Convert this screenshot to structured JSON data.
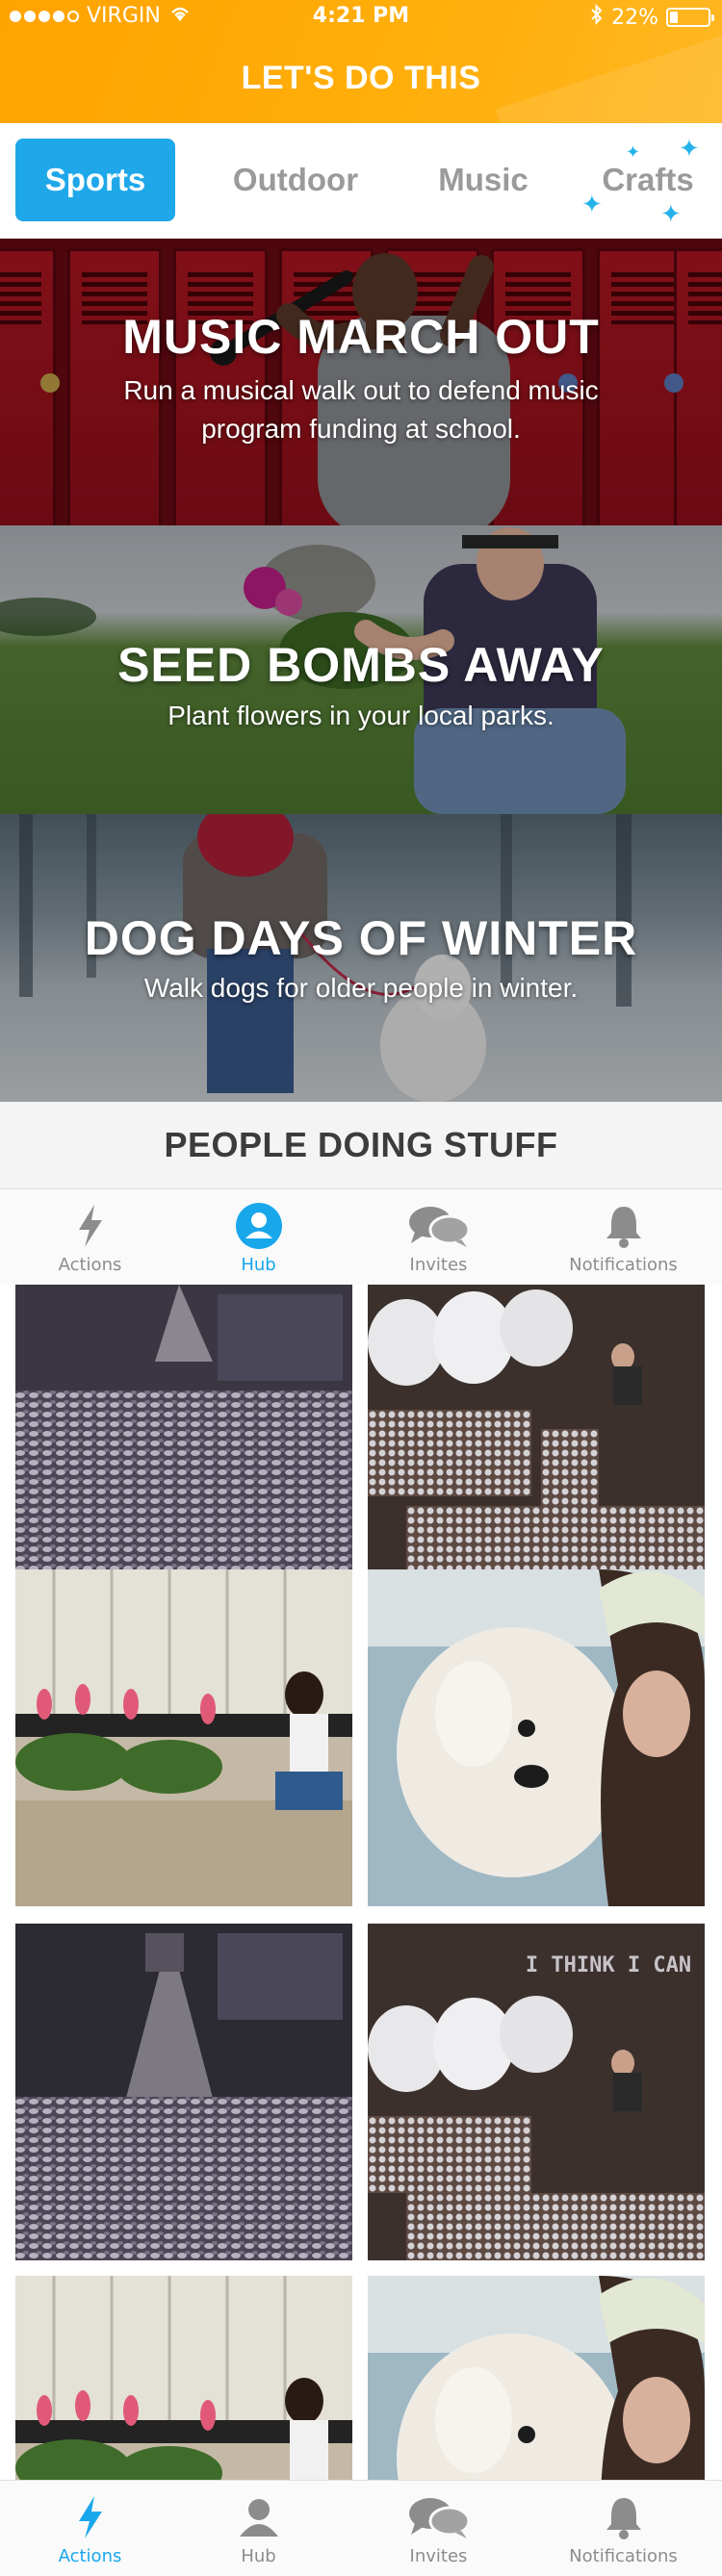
{
  "status_bar": {
    "carrier": "VIRGIN",
    "time": "4:21 PM",
    "battery_text": "22%",
    "battery_level": 0.22
  },
  "header": {
    "title": "LET'S DO THIS"
  },
  "categories": [
    {
      "label": "Sports",
      "active": true
    },
    {
      "label": "Outdoor",
      "active": false
    },
    {
      "label": "Music",
      "active": false
    },
    {
      "label": "Crafts",
      "active": false
    }
  ],
  "actions": [
    {
      "title": "MUSIC MARCH OUT",
      "description": "Run a musical walk out to defend music program funding at school."
    },
    {
      "title": "SEED BOMBS AWAY",
      "description": "Plant flowers in your local parks."
    },
    {
      "title": "DOG DAYS OF WINTER",
      "description": "Walk dogs for older people in winter."
    }
  ],
  "people_section": {
    "title": "PEOPLE DOING STUFF"
  },
  "hub_tabbar": {
    "items": [
      {
        "label": "Actions",
        "icon": "bolt-icon"
      },
      {
        "label": "Hub",
        "icon": "user-icon"
      },
      {
        "label": "Invites",
        "icon": "chat-bubbles-icon"
      },
      {
        "label": "Notifications",
        "icon": "bell-icon"
      }
    ],
    "active": "Hub"
  },
  "photos": [
    {
      "subject": "can-dress-pile"
    },
    {
      "subject": "cans-aerial-message"
    },
    {
      "subject": "girl-planting-flowers"
    },
    {
      "subject": "selfie-with-dog"
    },
    {
      "subject": "can-dress-pile"
    },
    {
      "subject": "cans-aerial-message",
      "caption": "I THINK I CAN"
    },
    {
      "subject": "girl-planting-flowers"
    },
    {
      "subject": "selfie-with-dog"
    }
  ],
  "bottom_tabbar": {
    "items": [
      {
        "label": "Actions",
        "icon": "bolt-icon"
      },
      {
        "label": "Hub",
        "icon": "user-icon"
      },
      {
        "label": "Invites",
        "icon": "chat-bubbles-icon"
      },
      {
        "label": "Notifications",
        "icon": "bell-icon"
      }
    ],
    "active": "Actions"
  },
  "colors": {
    "header_orange": "#ffa300",
    "accent_blue": "#1fa8e9",
    "inactive_gray": "#9a9a9a"
  }
}
